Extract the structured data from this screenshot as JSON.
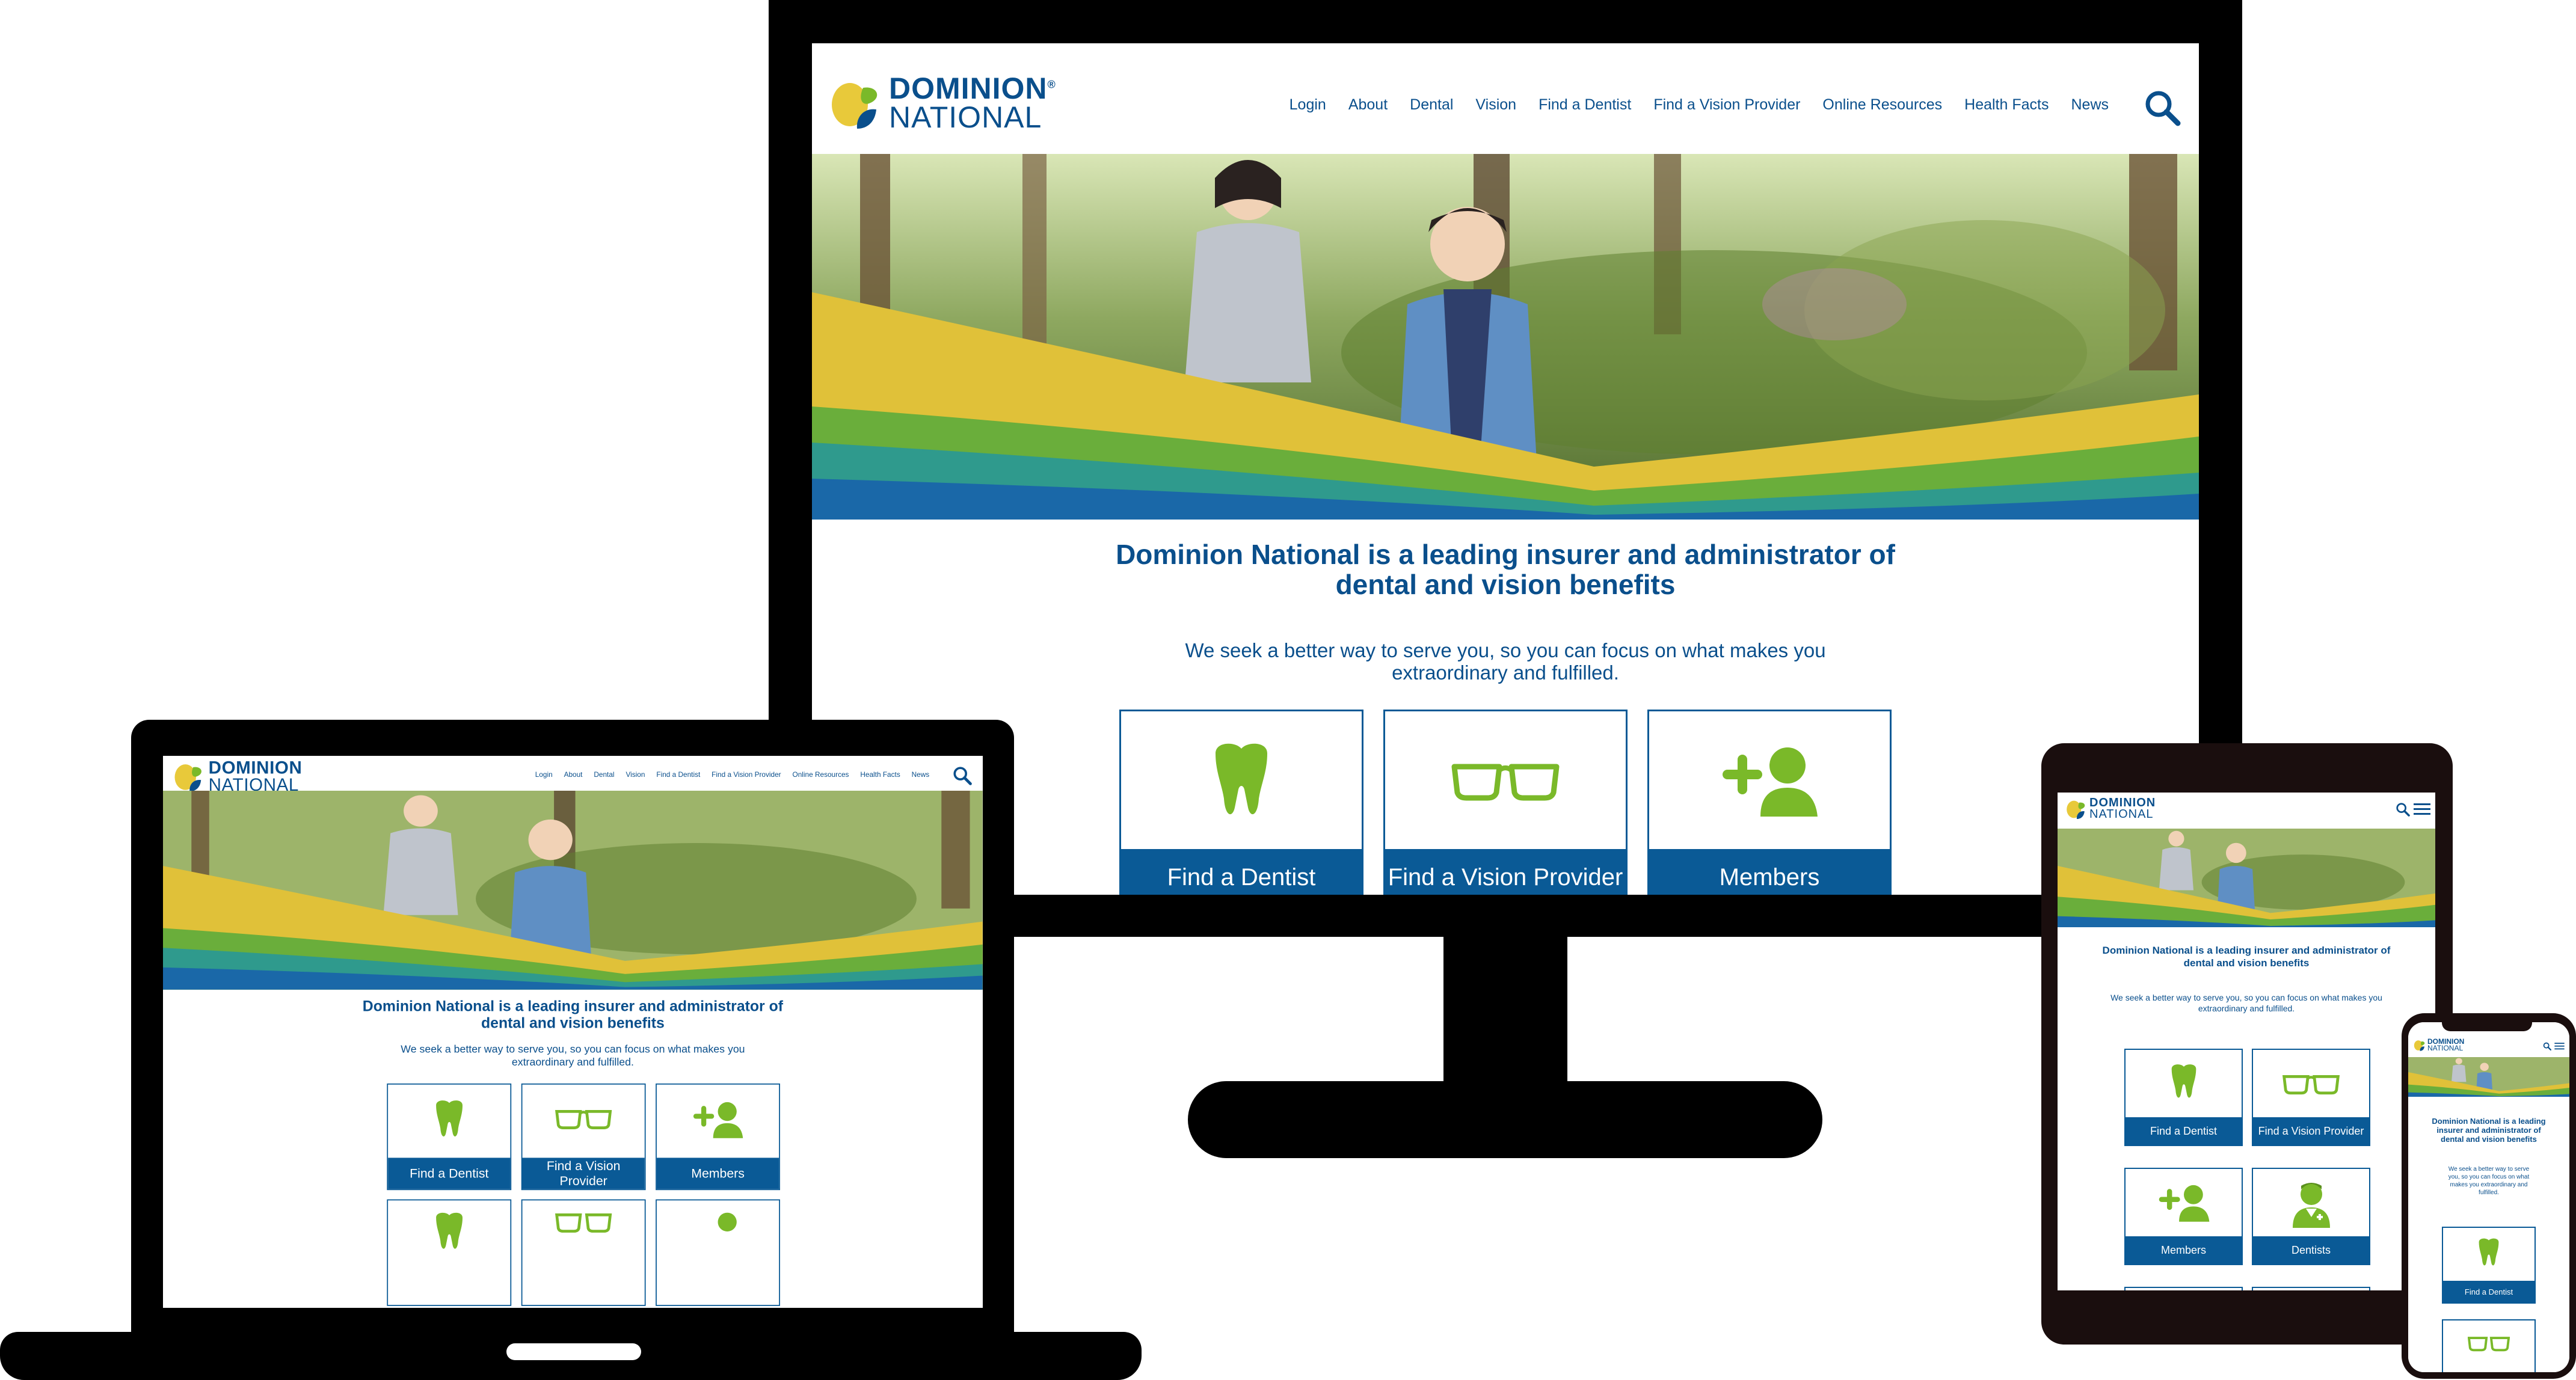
{
  "brand": {
    "name_line1": "DOMINION",
    "name_line2": "NATIONAL",
    "registered": "®",
    "colors": {
      "navy": "#0a4f8c",
      "blue": "#0a5a96",
      "green": "#7ab929",
      "yellow": "#e8c93a"
    }
  },
  "nav": {
    "items": [
      "Login",
      "About",
      "Dental",
      "Vision",
      "Find a Dentist",
      "Find a Vision Provider",
      "Online Resources",
      "Health Facts",
      "News"
    ],
    "search_icon": "search-icon",
    "menu_icon": "hamburger-icon"
  },
  "content": {
    "headline": "Dominion National is a leading insurer and administrator of dental and vision benefits",
    "headline_line1": "Dominion National is a leading insurer and administrator of",
    "headline_line2": "dental and vision benefits",
    "subtext": "We seek a better way to serve you, so you can focus on what makes you extraordinary and fulfilled.",
    "subtext_line1": "We seek a better way to serve you, so you can focus on what makes you",
    "subtext_line2": "extraordinary and fulfilled.",
    "phone_headline_lines": [
      "Dominion National is a leading",
      "insurer and administrator of",
      "dental and vision benefits"
    ],
    "phone_sub_lines": [
      "We seek a better way to serve",
      "you, so you can focus on what",
      "makes you extraordinary and",
      "fulfilled."
    ]
  },
  "cards": {
    "find_dentist": "Find a Dentist",
    "find_vision": "Find a Vision Provider",
    "members": "Members",
    "dentists": "Dentists"
  }
}
